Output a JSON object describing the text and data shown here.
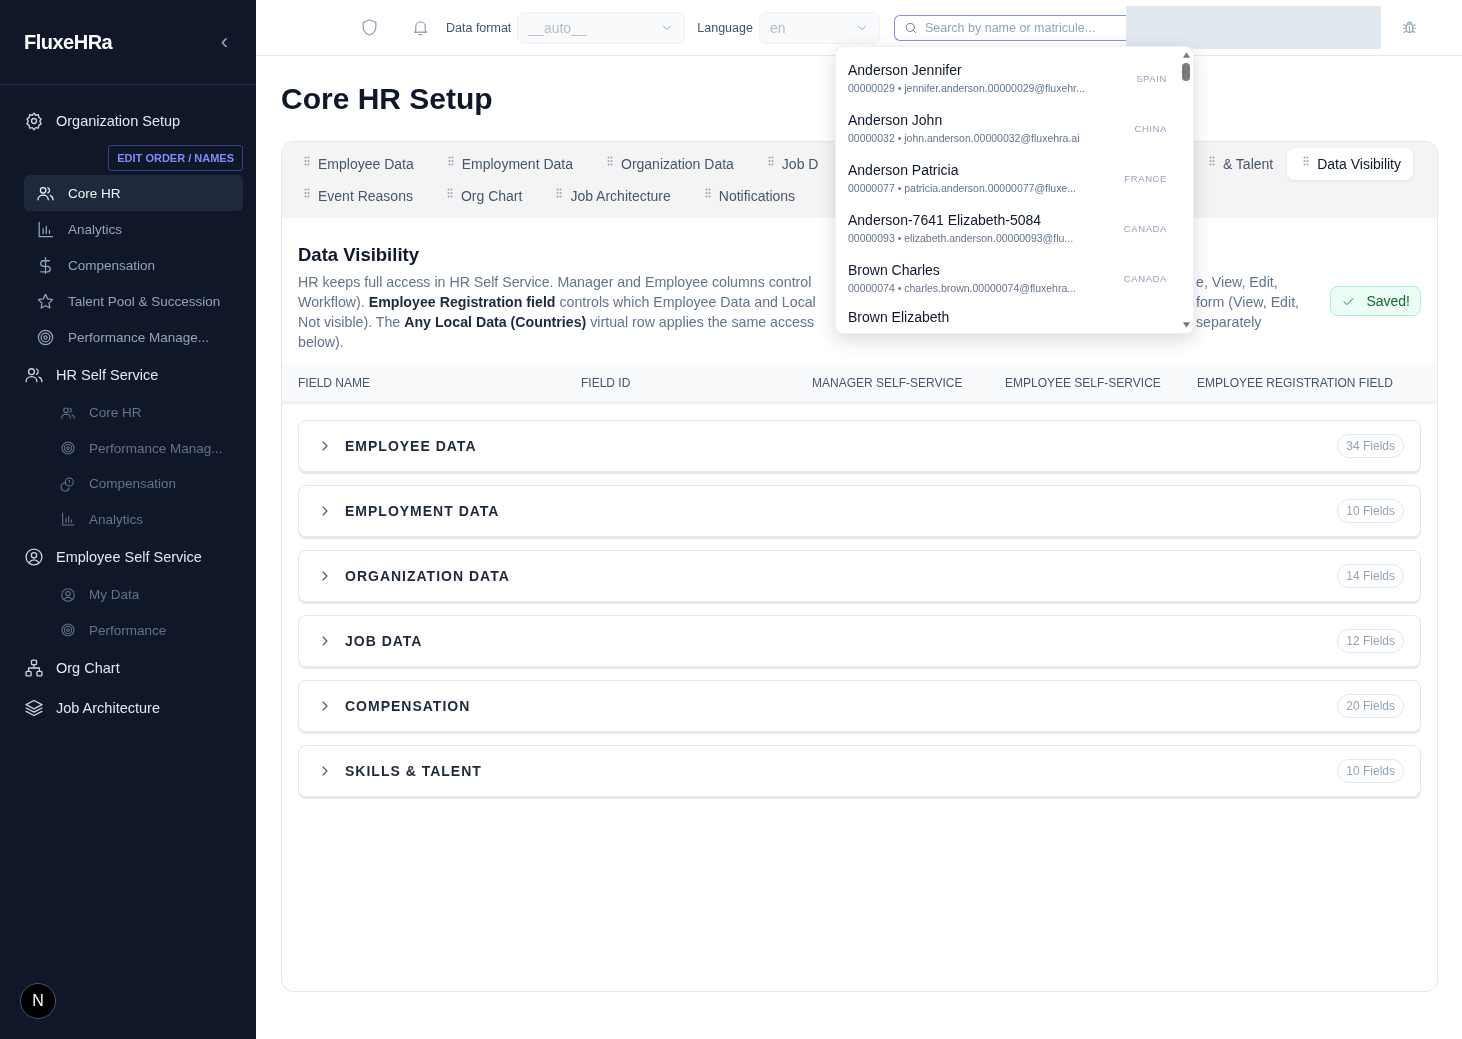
{
  "sidebar": {
    "logo": "FluxeHRa",
    "collapse_icon": "‹",
    "groups": [
      {
        "label": "Organization Setup",
        "kind": "admin",
        "action": "EDIT ORDER / NAMES",
        "children": [
          {
            "label": "Core HR",
            "selected": true
          },
          {
            "label": "Analytics",
            "selected": false
          },
          {
            "label": "Compensation",
            "selected": false
          },
          {
            "label": "Talent Pool & Succession",
            "selected": false
          },
          {
            "label": "Performance Manage...",
            "selected": false
          }
        ]
      },
      {
        "label": "HR Self Service",
        "kind": "service",
        "children": [
          {
            "label": "Core HR",
            "selected": false
          },
          {
            "label": "Performance Manag...",
            "selected": false
          },
          {
            "label": "Compensation",
            "selected": false
          },
          {
            "label": "Analytics",
            "selected": false
          }
        ]
      },
      {
        "label": "Employee Self Service",
        "kind": "service",
        "children": [
          {
            "label": "My Data",
            "selected": false
          },
          {
            "label": "Performance",
            "selected": false
          }
        ]
      },
      {
        "label": "Org Chart",
        "kind": "leaf"
      },
      {
        "label": "Job Architecture",
        "kind": "leaf"
      }
    ],
    "avatar": "N"
  },
  "topbar": {
    "data_format": {
      "label": "Data format",
      "value": "__auto__"
    },
    "language": {
      "label": "Language",
      "value": "en"
    },
    "search": {
      "placeholder": "Search by name or matricule..."
    }
  },
  "search_results": [
    {
      "name": "Anderson Jennifer",
      "detail": "00000029 • jennifer.anderson.00000029@fluxehr...",
      "country": "SPAIN"
    },
    {
      "name": "Anderson John",
      "detail": "00000032 • john.anderson.00000032@fluxehra.ai",
      "country": "CHINA"
    },
    {
      "name": "Anderson Patricia",
      "detail": "00000077 • patricia.anderson.00000077@fluxe...",
      "country": "FRANCE"
    },
    {
      "name": "Anderson-7641 Elizabeth-5084",
      "detail": "00000093 • elizabeth.anderson.00000093@flu...",
      "country": "CANADA"
    },
    {
      "name": "Brown Charles",
      "detail": "00000074 • charles.brown.00000074@fluxehra...",
      "country": "CANADA"
    },
    {
      "name": "Brown Elizabeth"
    }
  ],
  "page_title": "Core HR Setup",
  "tabs": {
    "row_1_left": [
      {
        "label": "Employee Data",
        "selected": false
      },
      {
        "label": "Employment Data",
        "selected": false
      },
      {
        "label": "Organization Data",
        "selected": false
      },
      {
        "label": "Job D",
        "selected": false
      }
    ],
    "row_1_right": [
      {
        "label": "& Talent",
        "selected": false
      },
      {
        "label": "Data Visibility",
        "selected": true
      }
    ],
    "row_2": [
      {
        "label": "Event Reasons",
        "selected": false
      },
      {
        "label": "Org Chart",
        "selected": false
      },
      {
        "label": "Job Architecture",
        "selected": false
      },
      {
        "label": "Notifications",
        "selected": false
      }
    ]
  },
  "section": {
    "title": "Data Visibility",
    "description_left": [
      "HR keeps full access in HR Self Service. Manager and Employee columns control",
      "Workflow). **Employee Registration field** controls which Employee Data and Local",
      "Not visible). The **Any Local Data (Countries)** virtual row applies the same access",
      "below)."
    ],
    "description_right": [
      "e, View, Edit,",
      "form (View, Edit,",
      "separately"
    ],
    "status": "Saved!"
  },
  "table": {
    "columns": [
      "FIELD NAME",
      "FIELD ID",
      "MANAGER SELF-SERVICE",
      "EMPLOYEE SELF-SERVICE",
      "EMPLOYEE REGISTRATION FIELD"
    ]
  },
  "groups": [
    {
      "title": "EMPLOYEE DATA",
      "count": "34 Fields",
      "expanded": false
    },
    {
      "title": "EMPLOYMENT DATA",
      "count": "10 Fields",
      "expanded": false
    },
    {
      "title": "ORGANIZATION DATA",
      "count": "14 Fields",
      "expanded": false
    },
    {
      "title": "JOB DATA",
      "count": "12 Fields",
      "expanded": false
    },
    {
      "title": "COMPENSATION",
      "count": "20 Fields",
      "expanded": false
    },
    {
      "title": "SKILLS & TALENT",
      "count": "10 Fields",
      "expanded": false
    }
  ]
}
